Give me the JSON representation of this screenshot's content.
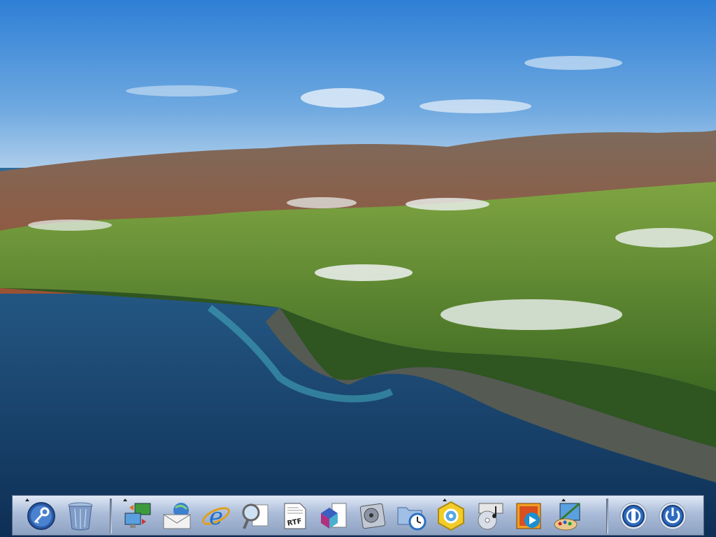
{
  "desktop": {
    "wallpaper": "coastal-mountains-wallpaper",
    "colors": {
      "sky_top": "#2c7dd6",
      "sky_bottom": "#bcd6ee",
      "sea": "#16456f",
      "hills": "#5d8a2c",
      "mountains": "#8c5a3e"
    }
  },
  "dock": {
    "items": [
      {
        "name": "keychain-icon",
        "indicator": true
      },
      {
        "name": "trash-icon",
        "indicator": false
      },
      {
        "name": "network-transfer-icon",
        "indicator": true
      },
      {
        "name": "mail-icon",
        "indicator": false
      },
      {
        "name": "internet-explorer-icon",
        "indicator": false
      },
      {
        "name": "search-magnifier-icon",
        "indicator": false
      },
      {
        "name": "rtf-document-icon",
        "indicator": false
      },
      {
        "name": "3d-cube-document-icon",
        "indicator": false
      },
      {
        "name": "disk-drive-icon",
        "indicator": false
      },
      {
        "name": "folder-clock-icon",
        "indicator": false
      },
      {
        "name": "settings-hexagon-icon",
        "indicator": true
      },
      {
        "name": "music-cd-icon",
        "indicator": false
      },
      {
        "name": "media-player-icon",
        "indicator": false
      },
      {
        "name": "paint-palette-icon",
        "indicator": true
      },
      {
        "name": "power-icon",
        "indicator": false
      },
      {
        "name": "shutdown-icon",
        "indicator": false
      }
    ]
  }
}
